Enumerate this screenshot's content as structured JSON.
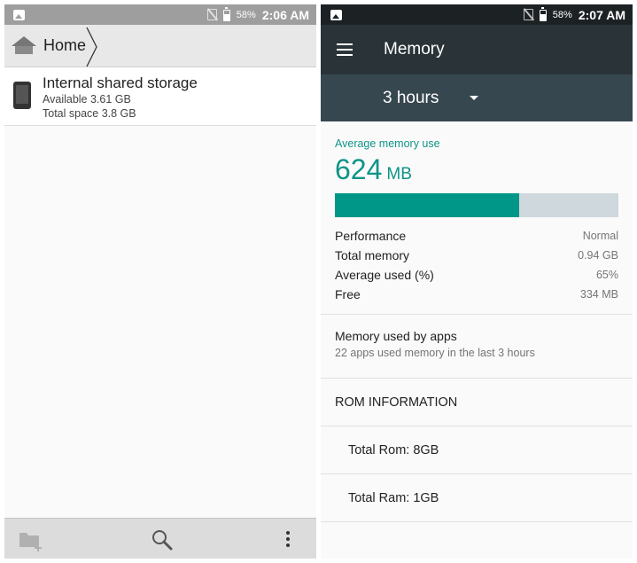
{
  "left": {
    "status_bar": {
      "battery_percent": "58%",
      "time": "2:06 AM"
    },
    "breadcrumb": {
      "home_label": "Home"
    },
    "storage": {
      "title": "Internal shared storage",
      "available": "Available 3.61 GB",
      "total": "Total space 3.8 GB"
    },
    "bottom_bar": {
      "icons": [
        "folder-add-icon",
        "search-icon",
        "more-vert-icon"
      ]
    }
  },
  "right": {
    "status_bar": {
      "battery_percent": "58%",
      "time": "2:07 AM"
    },
    "app_bar": {
      "title": "Memory"
    },
    "period": {
      "selected": "3 hours"
    },
    "memory": {
      "caption": "Average memory use",
      "value": "624",
      "unit": "MB",
      "usage_fraction": 0.65,
      "stats": [
        {
          "label": "Performance",
          "value": "Normal"
        },
        {
          "label": "Total memory",
          "value": "0.94 GB"
        },
        {
          "label": "Average used (%)",
          "value": "65%"
        },
        {
          "label": "Free",
          "value": "334 MB"
        }
      ]
    },
    "apps": {
      "title": "Memory used by apps",
      "subtitle": "22 apps used memory in the last 3 hours"
    },
    "rom": {
      "header": "ROM INFORMATION",
      "total_rom": "Total Rom: 8GB",
      "total_ram": "Total Ram: 1GB"
    },
    "colors": {
      "accent": "#009688",
      "app_bar": "#2a3438",
      "period_bar": "#37474f"
    }
  }
}
